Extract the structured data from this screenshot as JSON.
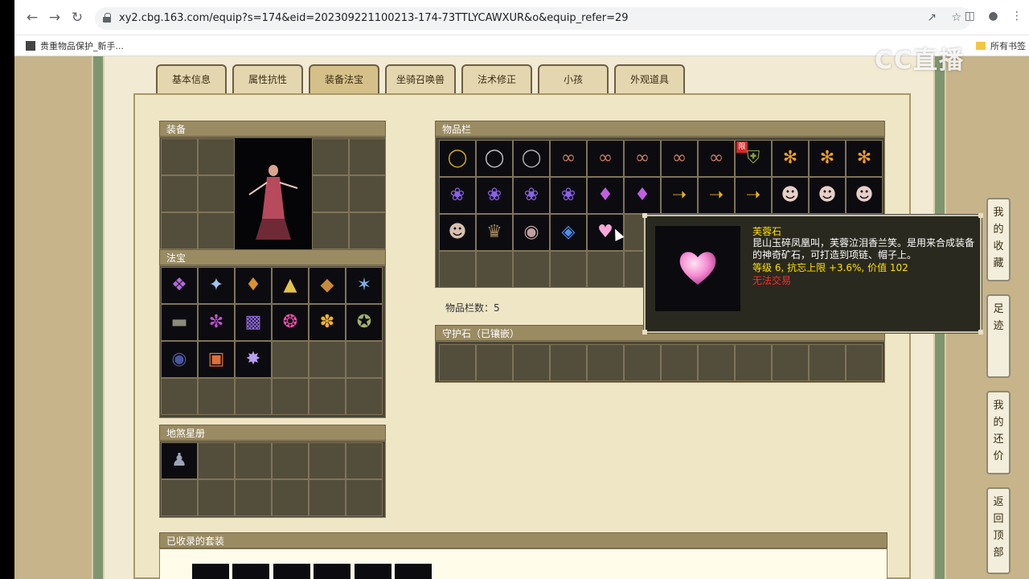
{
  "browser": {
    "url": "xy2.cbg.163.com/equip?s=174&eid=202309221100213-174-73TTLYCAWXUR&o&equip_refer=29",
    "bookmark_left": "贵重物品保护_新手...",
    "bookmark_right": "所有书签",
    "watermark": "CC直播"
  },
  "tabs": [
    {
      "label": "基本信息"
    },
    {
      "label": "属性抗性"
    },
    {
      "label": "装备法宝"
    },
    {
      "label": "坐骑召唤兽"
    },
    {
      "label": "法术修正"
    },
    {
      "label": "小孩"
    },
    {
      "label": "外观道具"
    }
  ],
  "panels": {
    "equip": "装备",
    "fabao": "法宝",
    "disha": "地煞星册",
    "inventory": "物品栏",
    "inventory_count": "物品栏数：5",
    "guard_stone": "守护石（已镶嵌）",
    "suits": "已收录的套装"
  },
  "inventory_badge": "限",
  "tooltip": {
    "name": "芙蓉石",
    "desc": "昆山玉碎凤凰叫，芙蓉泣泪香兰笑。是用来合成装备的神奇矿石，可打造到项链、帽子上。",
    "stats": "等级 6, 抗忘上限 +3.6%, 价值 102",
    "note": "无法交易"
  },
  "sidebar": [
    {
      "label": "我的收藏"
    },
    {
      "label": "足迹"
    },
    {
      "label": "我的还价"
    },
    {
      "label": "返回顶部"
    }
  ],
  "colors": {
    "accent": "#9a8b63",
    "tooltip_name": "#ffe100",
    "tooltip_note": "#ff2a2a"
  }
}
